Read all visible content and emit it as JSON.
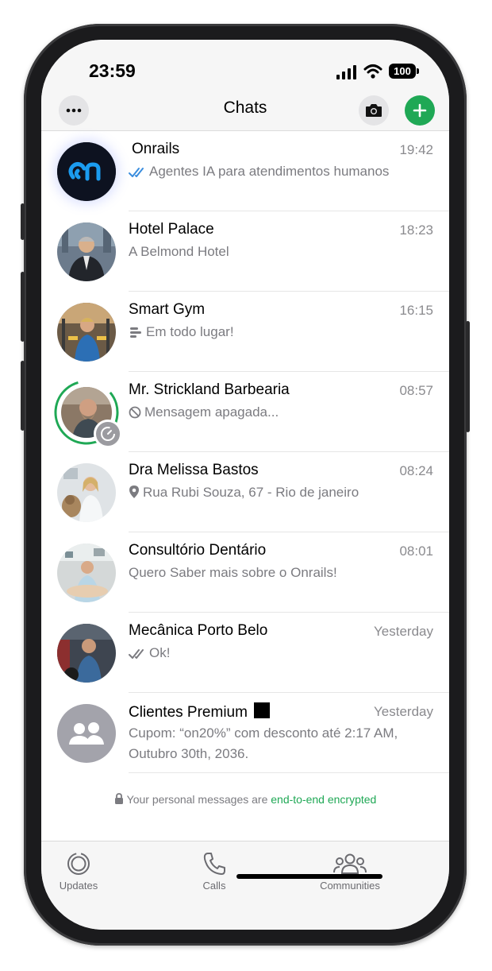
{
  "status_bar": {
    "time": "23:59",
    "battery": "100"
  },
  "header": {
    "title": "Chats"
  },
  "chats": [
    {
      "name": "Onrails",
      "time": "19:42",
      "preview": "Agentes IA para atendimentos humanos",
      "icon": "double-check-blue-icon"
    },
    {
      "name": "Hotel Palace",
      "time": "18:23",
      "preview": "A Belmond Hotel"
    },
    {
      "name": "Smart Gym",
      "time": "16:15",
      "preview": "Em todo lugar!",
      "icon": "list-icon"
    },
    {
      "name": "Mr. Strickland Barbearia",
      "time": "08:57",
      "preview": "Mensagem apagada...",
      "icon": "deleted-icon"
    },
    {
      "name": "Dra Melissa Bastos",
      "time": "08:24",
      "preview": "Rua Rubi Souza, 67 - Rio de janeiro",
      "icon": "location-pin-icon"
    },
    {
      "name": "Consultório Dentário",
      "time": "08:01",
      "preview": "Quero Saber mais sobre o Onrails!"
    },
    {
      "name": "Mecânica Porto Belo",
      "time": "Yesterday",
      "preview": "Ok!",
      "icon": "double-check-gray-icon"
    },
    {
      "name": "Clientes Premium",
      "time": "Yesterday",
      "preview": "Cupom: “on20%” com desconto até 2:17 AM, Outubro 30th, 2036."
    }
  ],
  "encryption": {
    "text": "Your personal messages are",
    "link": "end-to-end encrypted"
  },
  "tabs": [
    {
      "label": "Updates",
      "icon": "updates-icon"
    },
    {
      "label": "Calls",
      "icon": "phone-icon"
    },
    {
      "label": "Communities",
      "icon": "communities-icon"
    }
  ],
  "colors": {
    "accent": "#1fa855",
    "read_check": "#3a8dde",
    "onrails_logo": "#1b9cf0"
  }
}
